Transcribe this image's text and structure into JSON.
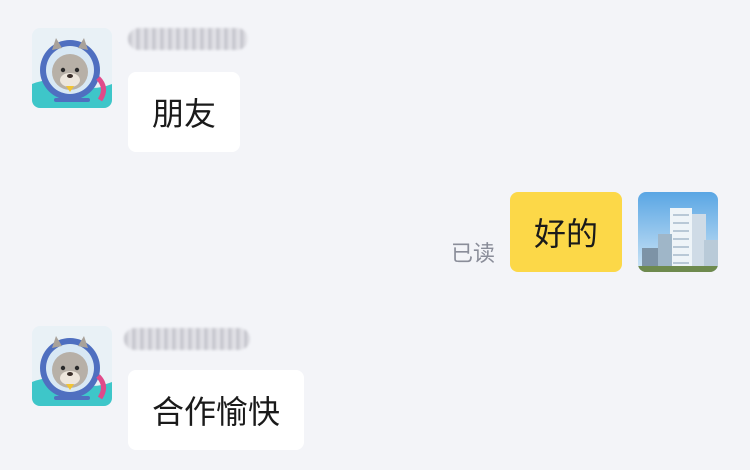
{
  "messages": [
    {
      "direction": "incoming",
      "text": "朋友",
      "sender_name": ""
    },
    {
      "direction": "outgoing",
      "text": "好的",
      "status": "已读"
    },
    {
      "direction": "incoming",
      "text": "合作愉快",
      "sender_name": ""
    }
  ],
  "colors": {
    "background": "#f3f4f8",
    "incoming_bubble": "#ffffff",
    "outgoing_bubble": "#fcd848",
    "status_text": "#8a8d99"
  },
  "icons": {
    "contact_avatar": "otter-astronaut-avatar",
    "self_avatar": "city-buildings-avatar"
  }
}
